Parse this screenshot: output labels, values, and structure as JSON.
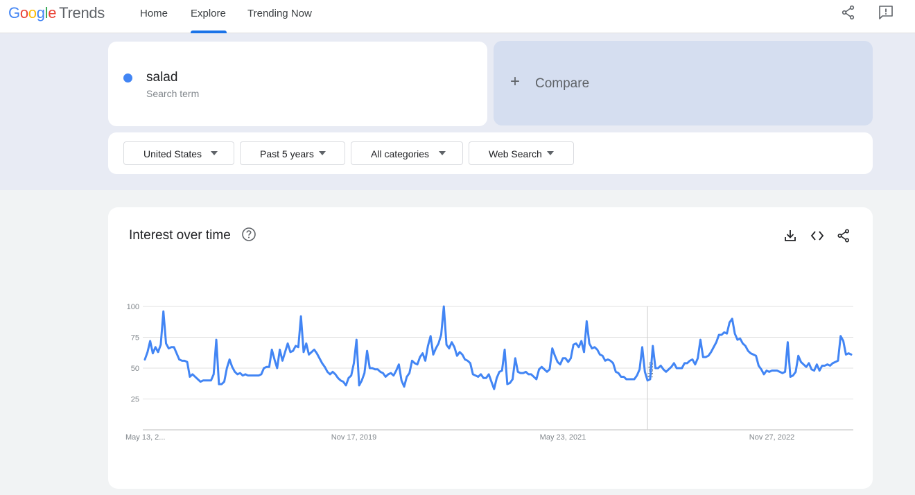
{
  "app": {
    "logo_google": [
      "G",
      "o",
      "o",
      "g",
      "l",
      "e"
    ],
    "logo_trends": "Trends"
  },
  "nav": {
    "home": "Home",
    "explore": "Explore",
    "trending": "Trending Now",
    "active": "Explore"
  },
  "search": {
    "term": "salad",
    "term_sub": "Search term",
    "term_color": "#4285f4",
    "compare_label": "Compare"
  },
  "filters": {
    "region": "United States",
    "period": "Past 5 years",
    "category": "All categories",
    "search_type": "Web Search"
  },
  "chart_panel": {
    "title": "Interest over time",
    "note_label": "Note"
  },
  "chart_data": {
    "type": "line",
    "title": "Interest over time",
    "xlabel": "",
    "ylabel": "",
    "ylim": [
      0,
      100
    ],
    "y_ticks": [
      25,
      50,
      75,
      100
    ],
    "x_tick_labels": [
      "May 13, 2...",
      "Nov 17, 2019",
      "May 23, 2021",
      "Nov 27, 2022"
    ],
    "x_tick_positions": [
      0,
      79,
      158,
      237
    ],
    "note_week": 190,
    "line_color": "#4285f4",
    "grid": true,
    "series": [
      {
        "values": [
          57,
          63,
          72,
          62,
          67,
          63,
          69,
          96,
          70,
          66,
          67,
          67,
          62,
          57,
          56,
          56,
          55,
          43,
          45,
          43,
          41,
          39,
          40,
          40,
          40,
          40,
          45,
          73,
          37,
          37,
          39,
          50,
          57,
          51,
          47,
          45,
          46,
          44,
          45,
          44,
          44,
          44,
          44,
          44,
          45,
          50,
          51,
          51,
          65,
          57,
          50,
          65,
          56,
          63,
          70,
          63,
          64,
          68,
          67,
          92,
          63,
          70,
          61,
          63,
          65,
          62,
          58,
          54,
          51,
          47,
          45,
          47,
          45,
          42,
          40,
          39,
          36,
          42,
          44,
          54,
          73,
          36,
          40,
          46,
          64,
          50,
          50,
          49,
          49,
          47,
          46,
          43,
          45,
          46,
          44,
          48,
          53,
          40,
          35,
          43,
          46,
          56,
          54,
          53,
          59,
          62,
          56,
          68,
          76,
          61,
          66,
          70,
          77,
          100,
          69,
          66,
          71,
          67,
          60,
          63,
          61,
          57,
          56,
          54,
          45,
          44,
          43,
          45,
          42,
          42,
          45,
          39,
          33,
          42,
          47,
          48,
          65,
          37,
          38,
          41,
          58,
          47,
          46,
          46,
          47,
          45,
          45,
          43,
          41,
          49,
          51,
          49,
          47,
          49,
          66,
          60,
          55,
          53,
          58,
          58,
          55,
          58,
          69,
          70,
          67,
          72,
          63,
          88,
          70,
          66,
          67,
          65,
          61,
          60,
          56,
          57,
          56,
          54,
          47,
          46,
          43,
          43,
          41,
          41,
          41,
          41,
          44,
          49,
          67,
          47,
          40,
          41,
          68,
          50,
          50,
          52,
          49,
          47,
          49,
          51,
          54,
          50,
          50,
          50,
          54,
          54,
          56,
          57,
          53,
          58,
          73,
          59,
          59,
          60,
          63,
          67,
          71,
          77,
          77,
          79,
          78,
          87,
          90,
          78,
          73,
          74,
          70,
          68,
          64,
          62,
          61,
          60,
          52,
          49,
          45,
          48,
          47,
          48,
          48,
          48,
          47,
          46,
          47,
          71,
          43,
          44,
          47,
          60,
          55,
          53,
          51,
          54,
          49,
          48,
          53,
          48,
          52,
          52,
          53,
          52,
          54,
          55,
          56,
          76,
          72,
          61,
          62,
          61
        ]
      }
    ]
  }
}
